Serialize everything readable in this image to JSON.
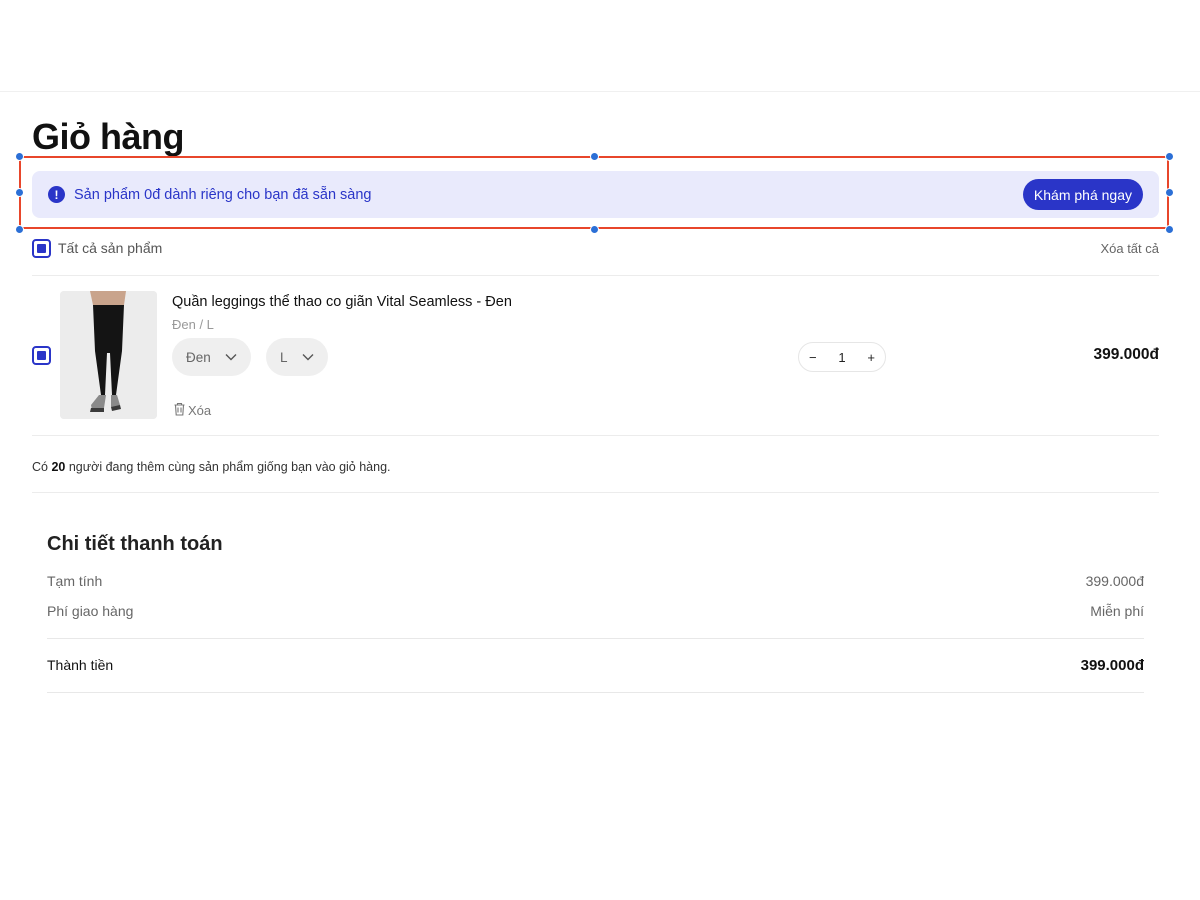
{
  "page": {
    "title": "Giỏ hàng"
  },
  "promo": {
    "text": "Sản phẩm 0đ dành riêng cho bạn đã sẵn sàng",
    "button_label": "Khám phá ngay",
    "icon": "exclamation-circle-icon"
  },
  "cart": {
    "select_all_label": "Tất cả sản phẩm",
    "clear_all_label": "Xóa tất cả",
    "items": [
      {
        "name": "Quần leggings thể thao co giãn Vital Seamless - Đen",
        "variant": "Đen  /  L",
        "color": "Đen",
        "size": "L",
        "quantity": "1",
        "price": "399.000đ",
        "remove_label": "Xóa",
        "selected": true
      }
    ],
    "social_note": {
      "prefix": "Có",
      "count": "20",
      "suffix": "người đang thêm cùng sản phẩm giống bạn vào giỏ hàng."
    }
  },
  "summary": {
    "title": "Chi tiết thanh toán",
    "subtotal_label": "Tạm tính",
    "subtotal_value": "399.000đ",
    "shipping_label": "Phí giao hàng",
    "shipping_value": "Miễn phí",
    "total_label": "Thành tiền",
    "total_value": "399.000đ"
  },
  "colors": {
    "accent": "#2a35c8",
    "promo_bg": "#e9eafc",
    "selection_border": "#e8462b",
    "selection_handle": "#2b6fd6"
  }
}
